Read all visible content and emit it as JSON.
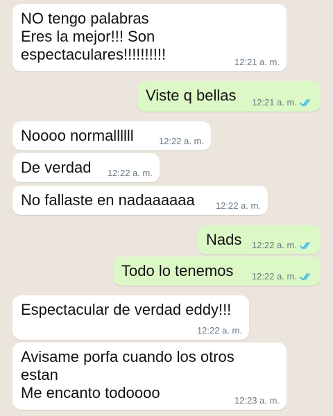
{
  "messages": [
    {
      "direction": "incoming",
      "text": "NO tengo palabras\nEres la mejor!!! Son\nespectaculares!!!!!!!!!!",
      "time": "12:21 a. m."
    },
    {
      "direction": "outgoing",
      "text": "Viste q bellas",
      "time": "12:21 a. m.",
      "read": true
    },
    {
      "direction": "incoming",
      "text": "Noooo normallllll",
      "time": "12:22 a. m."
    },
    {
      "direction": "incoming",
      "text": "De verdad",
      "time": "12:22 a. m."
    },
    {
      "direction": "incoming",
      "text": "No fallaste en nadaaaaaa",
      "time": "12:22 a. m."
    },
    {
      "direction": "outgoing",
      "text": "Nads",
      "time": "12:22 a. m.",
      "read": true
    },
    {
      "direction": "outgoing",
      "text": "Todo lo tenemos",
      "time": "12:22 a. m.",
      "read": true
    },
    {
      "direction": "incoming",
      "text": "Espectacular de verdad eddy!!!",
      "time": "12:22 a. m."
    },
    {
      "direction": "incoming",
      "text": "Avisame porfa cuando los otros\nestan\nMe encanto todoooo",
      "time": "12:23 a. m."
    }
  ],
  "colors": {
    "background": "#ECE5DD",
    "incoming_bubble": "#FFFFFF",
    "outgoing_bubble": "#DCF8C6",
    "read_ticks": "#34B7F1",
    "timestamp": "#667781"
  },
  "icons": {
    "read_receipt": "double-check-icon"
  }
}
